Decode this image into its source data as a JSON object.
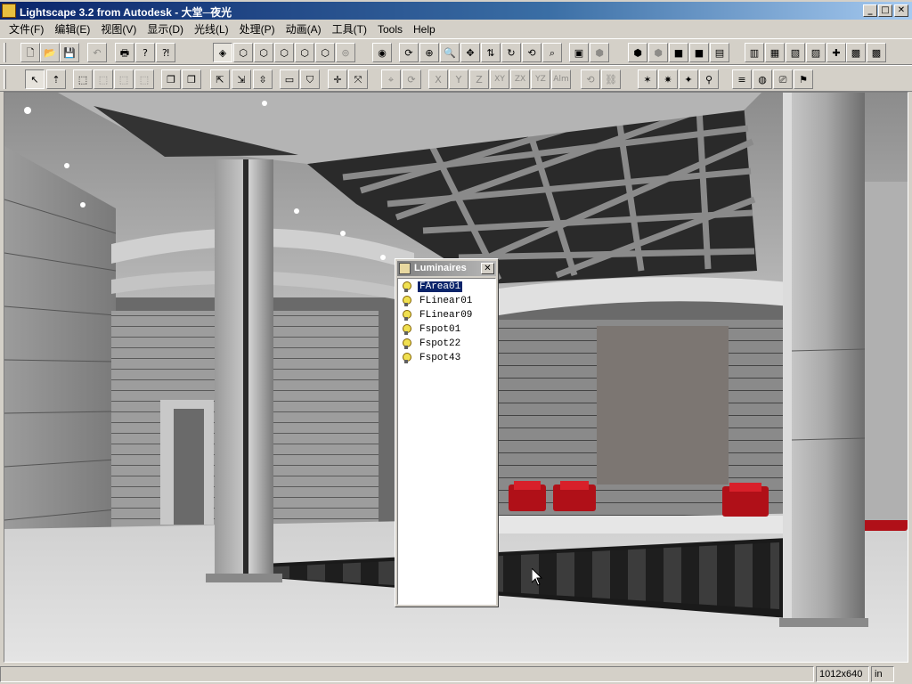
{
  "window": {
    "title": "Lightscape 3.2 from Autodesk - 大堂─夜光",
    "minimize_glyph": "_",
    "maximize_glyph": "□",
    "close_glyph": "✕"
  },
  "menu": [
    "文件(F)",
    "编辑(E)",
    "视图(V)",
    "显示(D)",
    "光线(L)",
    "处理(P)",
    "动画(A)",
    "工具(T)",
    "Tools",
    "Help"
  ],
  "toolbar1": {
    "buttons": [
      {
        "name": "new-icon",
        "glyph": "🗋"
      },
      {
        "name": "open-icon",
        "glyph": "📂"
      },
      {
        "name": "save-icon",
        "glyph": "💾"
      },
      {
        "name": "undo-icon",
        "glyph": "↶"
      },
      {
        "name": "print-icon",
        "glyph": "🖶"
      },
      {
        "name": "help-icon",
        "glyph": "?"
      },
      {
        "name": "context-help-icon",
        "glyph": "⁈"
      },
      {
        "name": "view-perspective-icon",
        "glyph": "◈"
      },
      {
        "name": "view-top-icon",
        "glyph": "⬡"
      },
      {
        "name": "view-front-icon",
        "glyph": "⬡"
      },
      {
        "name": "view-side-icon",
        "glyph": "⬡"
      },
      {
        "name": "view-iso-icon",
        "glyph": "⬡"
      },
      {
        "name": "view-back-icon",
        "glyph": "⬡"
      },
      {
        "name": "zoom-extents-icon",
        "glyph": "⊚"
      },
      {
        "name": "walk-eye-icon",
        "glyph": "◉"
      },
      {
        "name": "orbit-icon",
        "glyph": "⟳"
      },
      {
        "name": "dolly-icon",
        "glyph": "⊕"
      },
      {
        "name": "zoom-icon",
        "glyph": "🔍"
      },
      {
        "name": "pan-icon",
        "glyph": "✥"
      },
      {
        "name": "tilt-icon",
        "glyph": "⇅"
      },
      {
        "name": "rotate-view-icon",
        "glyph": "↻"
      },
      {
        "name": "refresh-icon",
        "glyph": "⟲"
      },
      {
        "name": "zoom-window-icon",
        "glyph": "⌕"
      },
      {
        "name": "fit-icon",
        "glyph": "▣"
      },
      {
        "name": "wireframe-icon",
        "glyph": "⬢"
      },
      {
        "name": "solid-shade-icon",
        "glyph": "⬢"
      },
      {
        "name": "outline-shade-icon",
        "glyph": "⬢"
      },
      {
        "name": "green-cube-icon",
        "glyph": "■"
      },
      {
        "name": "green-box-icon",
        "glyph": "■"
      },
      {
        "name": "layer-icon",
        "glyph": "▤"
      },
      {
        "name": "block-icon",
        "glyph": "▥"
      },
      {
        "name": "material-icon",
        "glyph": "▦"
      },
      {
        "name": "texture-icon",
        "glyph": "▧"
      },
      {
        "name": "render-icon",
        "glyph": "▨"
      },
      {
        "name": "logo-icon",
        "glyph": "✚"
      },
      {
        "name": "misc-icon",
        "glyph": "▩"
      },
      {
        "name": "misc2-icon",
        "glyph": "▩"
      }
    ]
  },
  "toolbar2": {
    "buttons": [
      {
        "name": "select-arrow-icon",
        "glyph": "↖"
      },
      {
        "name": "select-query-icon",
        "glyph": "⇡"
      },
      {
        "name": "select-window-icon",
        "glyph": "⬚"
      },
      {
        "name": "select-crossing-icon",
        "glyph": "⬚"
      },
      {
        "name": "select-add-icon",
        "glyph": "⬚"
      },
      {
        "name": "select-remove-icon",
        "glyph": "⬚"
      },
      {
        "name": "copy-object-icon",
        "glyph": "❐"
      },
      {
        "name": "paste-object-icon",
        "glyph": "❐"
      },
      {
        "name": "object-pick-icon",
        "glyph": "⇱"
      },
      {
        "name": "object-transform-icon",
        "glyph": "⇲"
      },
      {
        "name": "object-align-icon",
        "glyph": "⇳"
      },
      {
        "name": "surface-icon",
        "glyph": "▭"
      },
      {
        "name": "filter-icon",
        "glyph": "⛉"
      },
      {
        "name": "move-icon",
        "glyph": "✛"
      },
      {
        "name": "scale-icon",
        "glyph": "⤧"
      },
      {
        "name": "snap-icon",
        "glyph": "⌖"
      },
      {
        "name": "rotate-icon",
        "glyph": "⟳"
      },
      {
        "name": "axis-x-icon",
        "glyph": "X"
      },
      {
        "name": "axis-y-icon",
        "glyph": "Y"
      },
      {
        "name": "axis-z-icon",
        "glyph": "Z"
      },
      {
        "name": "plane-xy-icon",
        "glyph": "XY"
      },
      {
        "name": "plane-zx-icon",
        "glyph": "ZX"
      },
      {
        "name": "plane-yz-icon",
        "glyph": "YZ"
      },
      {
        "name": "align-icon",
        "glyph": "Alm"
      },
      {
        "name": "reset-icon",
        "glyph": "⟲"
      },
      {
        "name": "link-icon",
        "glyph": "⛓"
      },
      {
        "name": "light-walk-icon",
        "glyph": "✶"
      },
      {
        "name": "light-aim-icon",
        "glyph": "✷"
      },
      {
        "name": "figure-icon",
        "glyph": "✦"
      },
      {
        "name": "pin-icon",
        "glyph": "⚲"
      },
      {
        "name": "layers-icon",
        "glyph": "≡"
      },
      {
        "name": "globe-icon",
        "glyph": "◍"
      },
      {
        "name": "camera-icon",
        "glyph": "⎚"
      },
      {
        "name": "luminaire-tool-icon",
        "glyph": "⚑"
      }
    ]
  },
  "luminaires_panel": {
    "title": "Luminaires",
    "close_glyph": "✕",
    "items": [
      {
        "label": "FArea01",
        "selected": true
      },
      {
        "label": "FLinear01",
        "selected": false
      },
      {
        "label": "FLinear09",
        "selected": false
      },
      {
        "label": "Fspot01",
        "selected": false
      },
      {
        "label": "Fspot22",
        "selected": false
      },
      {
        "label": "Fspot43",
        "selected": false
      }
    ]
  },
  "statusbar": {
    "resolution": "1012x640",
    "units": "in"
  }
}
